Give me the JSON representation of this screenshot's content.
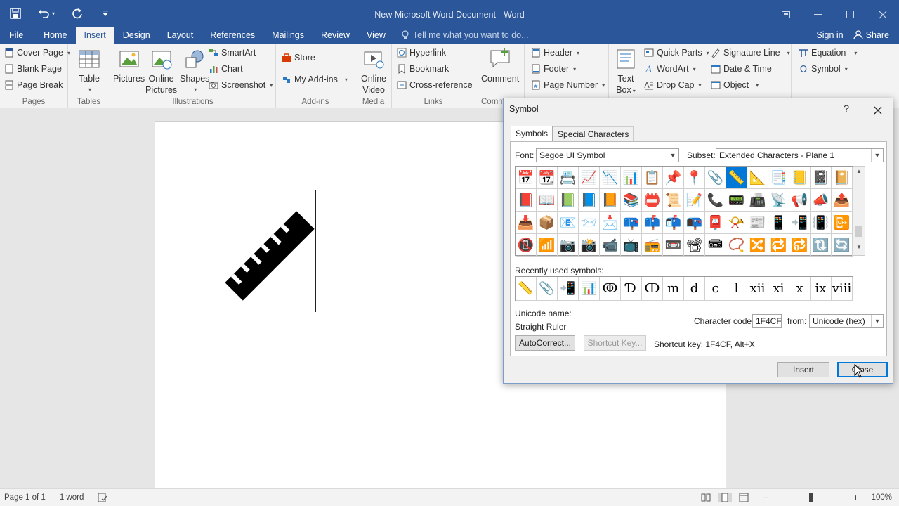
{
  "window": {
    "title": "New Microsoft Word Document - Word",
    "qat": [
      "save-icon",
      "undo-icon",
      "redo-icon",
      "customize-icon"
    ]
  },
  "tabs": {
    "file": "File",
    "items": [
      "Home",
      "Insert",
      "Design",
      "Layout",
      "References",
      "Mailings",
      "Review",
      "View"
    ],
    "active": "Insert",
    "tell_me": "Tell me what you want to do...",
    "sign_in": "Sign in",
    "share": "Share"
  },
  "ribbon": {
    "pages": {
      "label": "Pages",
      "cover_page": "Cover Page",
      "blank_page": "Blank Page",
      "page_break": "Page Break"
    },
    "tables": {
      "label": "Tables",
      "table": "Table"
    },
    "illustrations": {
      "label": "Illustrations",
      "pictures": "Pictures",
      "online_pictures_1": "Online",
      "online_pictures_2": "Pictures",
      "shapes": "Shapes",
      "smartart": "SmartArt",
      "chart": "Chart",
      "screenshot": "Screenshot"
    },
    "addins": {
      "label": "Add-ins",
      "store": "Store",
      "my_addins": "My Add-ins"
    },
    "media": {
      "label": "Media",
      "online_video_1": "Online",
      "online_video_2": "Video"
    },
    "links": {
      "label": "Links",
      "hyperlink": "Hyperlink",
      "bookmark": "Bookmark",
      "cross_reference": "Cross-reference"
    },
    "comments": {
      "label": "Comm",
      "comment": "Comment"
    },
    "header_footer": {
      "header": "Header",
      "footer": "Footer",
      "page_number": "Page Number"
    },
    "text": {
      "text_box_1": "Text",
      "text_box_2": "Box",
      "quick_parts": "Quick Parts",
      "wordart": "WordArt",
      "drop_cap": "Drop Cap",
      "signature_line": "Signature Line",
      "date_time": "Date & Time",
      "object": "Object"
    },
    "symbols": {
      "equation": "Equation",
      "symbol": "Symbol"
    }
  },
  "status": {
    "page": "Page 1 of 1",
    "words": "1 word",
    "zoom": "100%"
  },
  "dialog": {
    "title": "Symbol",
    "help": "?",
    "tabs": [
      "Symbols",
      "Special Characters"
    ],
    "font_label": "Font:",
    "font_value": "Segoe UI Symbol",
    "subset_label": "Subset:",
    "subset_value": "Extended Characters - Plane 1",
    "symbols": [
      "📅",
      "📆",
      "📇",
      "📈",
      "📉",
      "📊",
      "📋",
      "📌",
      "📍",
      "📎",
      "📏",
      "📐",
      "📑",
      "📒",
      "📓",
      "📔",
      "📕",
      "📖",
      "📗",
      "📘",
      "📙",
      "📚",
      "📛",
      "📜",
      "📝",
      "📞",
      "📟",
      "📠",
      "📡",
      "📢",
      "📣",
      "📤",
      "📥",
      "📦",
      "📧",
      "📨",
      "📩",
      "📪",
      "📫",
      "📬",
      "📭",
      "📮",
      "📯",
      "📰",
      "📱",
      "📲",
      "📳",
      "📴",
      "📵",
      "📶",
      "📷",
      "📸",
      "📹",
      "📺",
      "📻",
      "📼",
      "📽",
      "📾",
      "📿",
      "🔀",
      "🔁",
      "🔂",
      "🔃",
      "🔄"
    ],
    "selected_index": 10,
    "recent_label": "Recently used symbols:",
    "recent": [
      "📏",
      "📎",
      "📲",
      "📊",
      "ↂ",
      "Ɗ",
      "ↀ",
      "m",
      "d",
      "c",
      "l",
      "xii",
      "xi",
      "x",
      "ix",
      "viii"
    ],
    "unicode_name_label": "Unicode name:",
    "unicode_name": "Straight Ruler",
    "char_code_label": "Character code:",
    "char_code": "1F4CF",
    "from_label": "from:",
    "from_value": "Unicode (hex)",
    "autocorrect": "AutoCorrect...",
    "shortcut_key_btn": "Shortcut Key...",
    "shortcut_key_text": "Shortcut key: 1F4CF, Alt+X",
    "insert": "Insert",
    "close": "Close"
  }
}
